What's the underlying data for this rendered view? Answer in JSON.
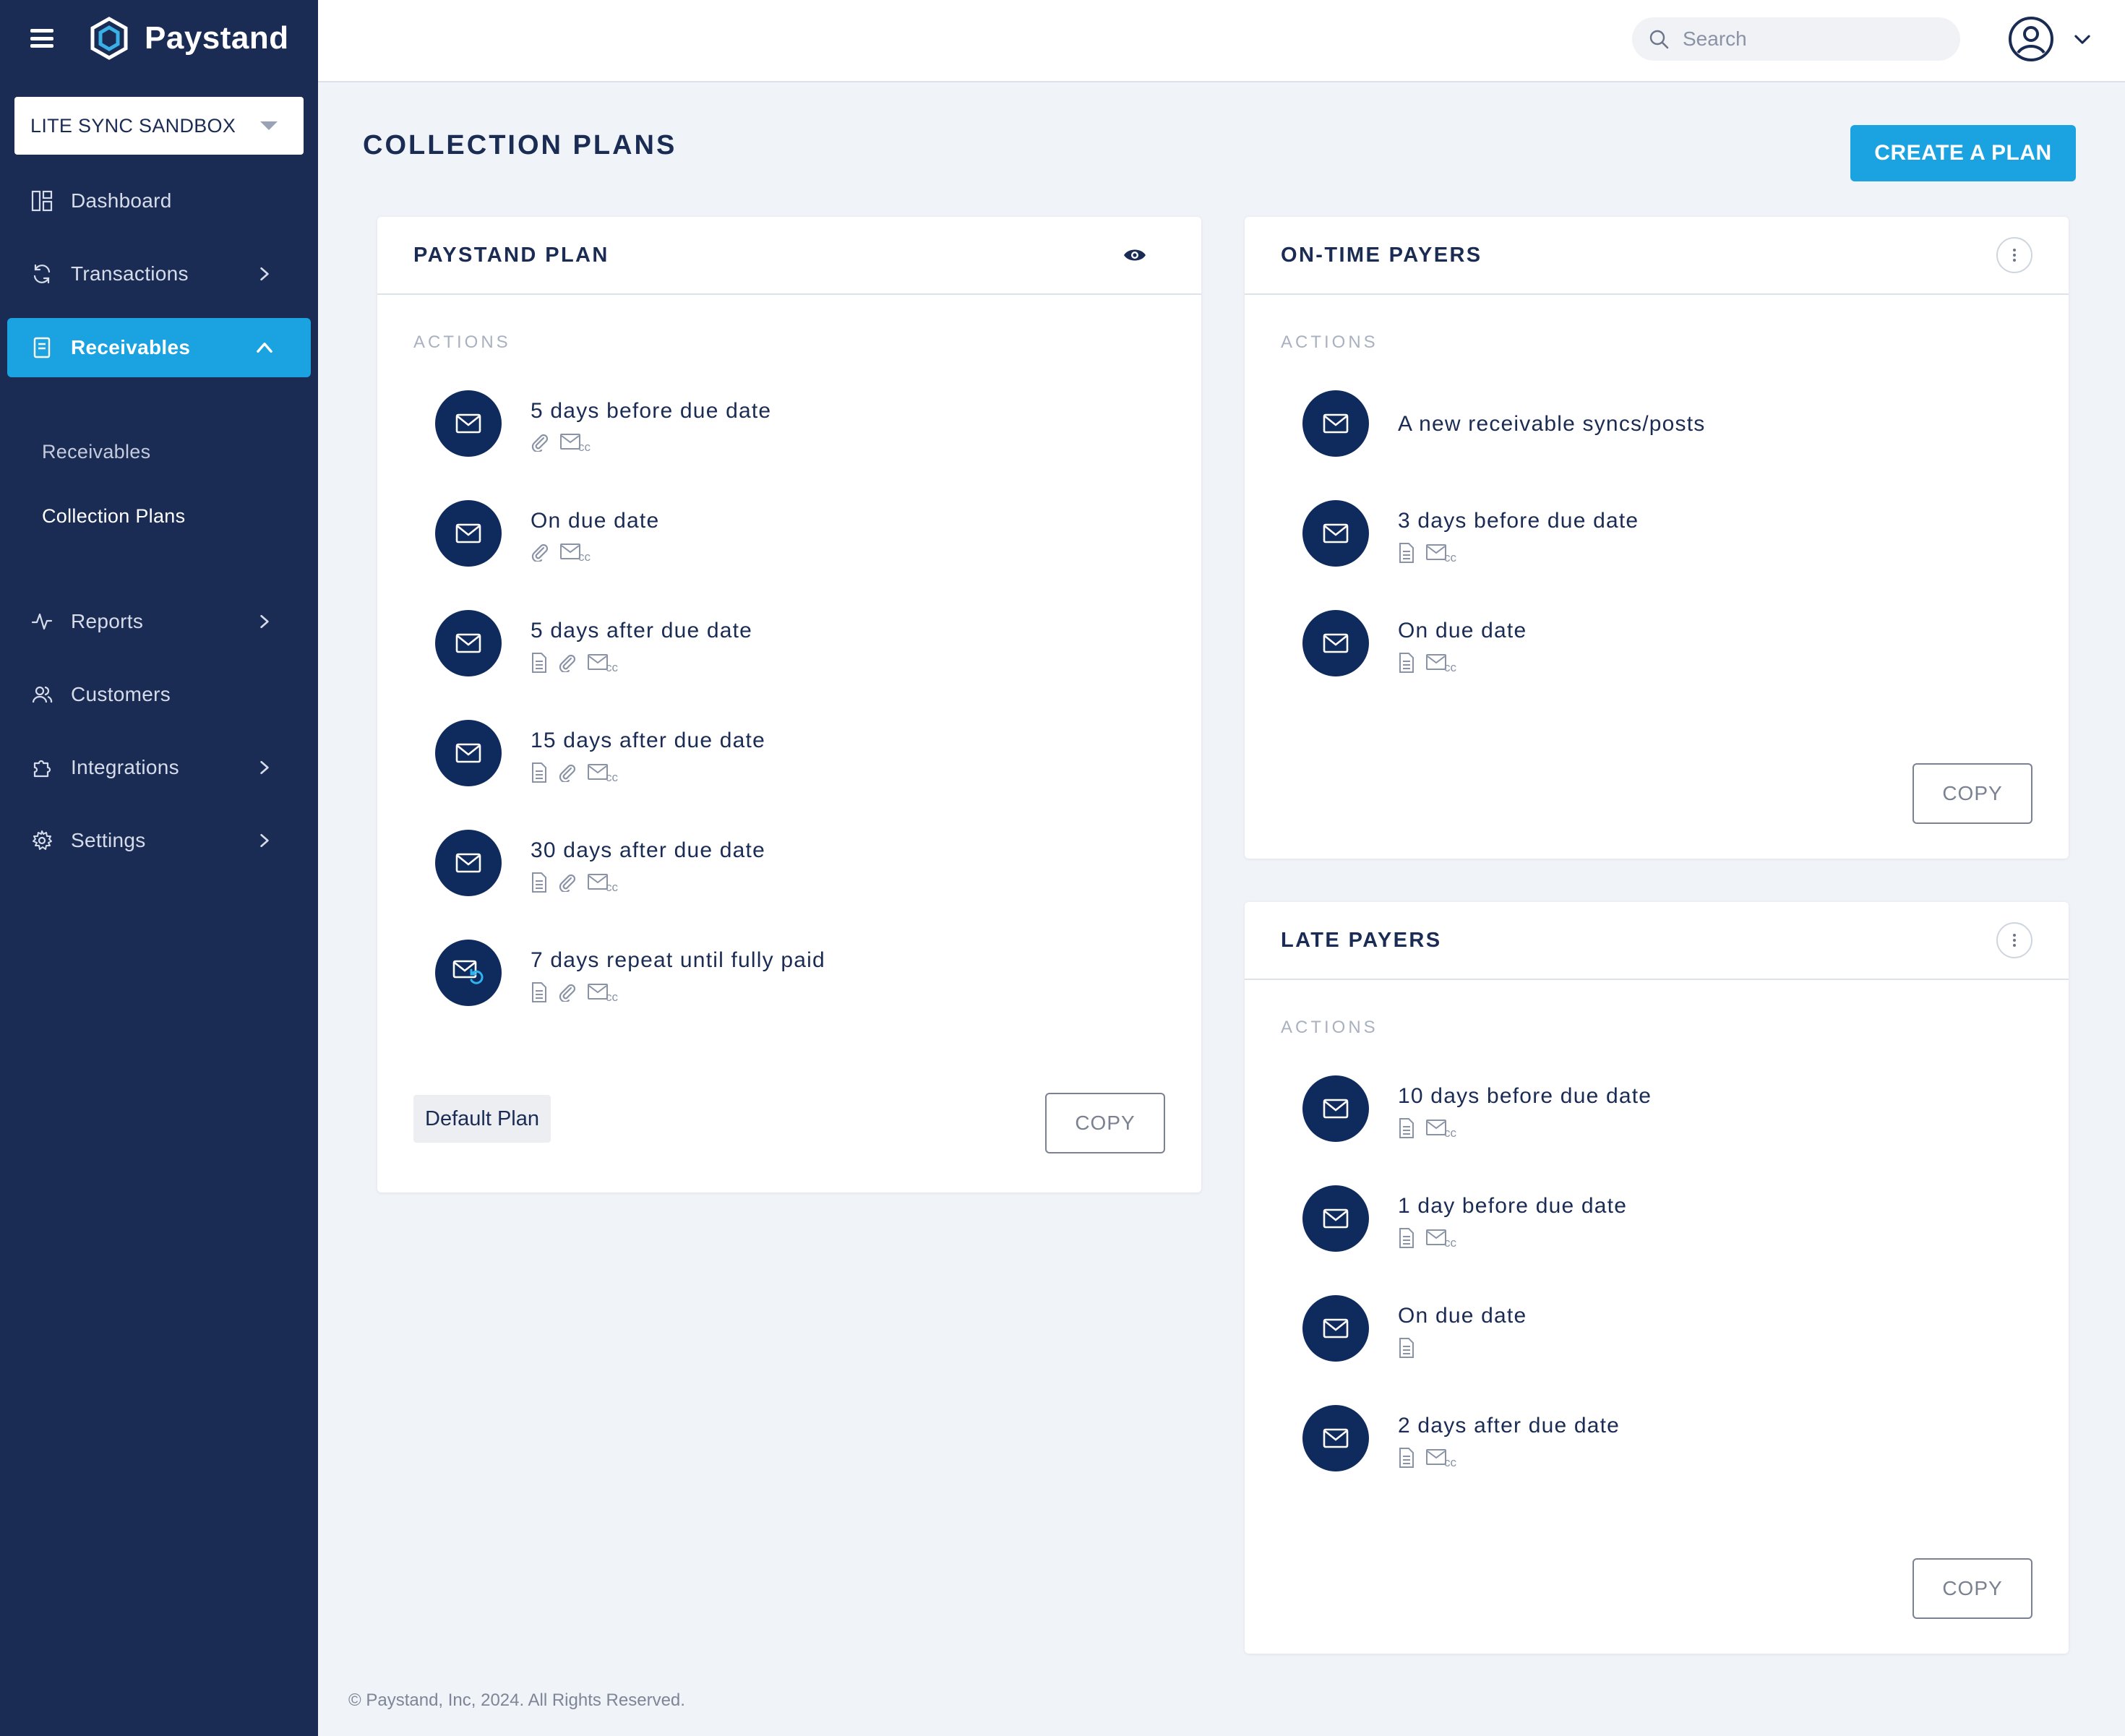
{
  "brand": {
    "name": "Paystand"
  },
  "org_select": {
    "value": "LITE SYNC SANDBOX"
  },
  "sidebar": {
    "items": [
      {
        "label": "Dashboard"
      },
      {
        "label": "Transactions"
      },
      {
        "label": "Receivables"
      },
      {
        "label": "Reports"
      },
      {
        "label": "Customers"
      },
      {
        "label": "Integrations"
      },
      {
        "label": "Settings"
      }
    ],
    "sub_items": [
      {
        "label": "Receivables"
      },
      {
        "label": "Collection Plans"
      }
    ]
  },
  "topbar": {
    "search_placeholder": "Search"
  },
  "page": {
    "title": "COLLECTION PLANS",
    "create_label": "CREATE A PLAN"
  },
  "cards": {
    "paystand": {
      "title": "PAYSTAND PLAN",
      "actions_label": "ACTIONS",
      "actions": [
        {
          "title": "5 days before due date"
        },
        {
          "title": "On due date"
        },
        {
          "title": "5 days after due date"
        },
        {
          "title": "15 days after due date"
        },
        {
          "title": "30 days after due date"
        },
        {
          "title": "7 days repeat until fully paid"
        }
      ],
      "badge": "Default Plan",
      "copy_label": "COPY"
    },
    "ontime": {
      "title": "ON-TIME PAYERS",
      "actions_label": "ACTIONS",
      "actions": [
        {
          "title": "A new receivable syncs/posts"
        },
        {
          "title": "3 days before due date"
        },
        {
          "title": "On due date"
        }
      ],
      "copy_label": "COPY"
    },
    "late": {
      "title": "LATE PAYERS",
      "actions_label": "ACTIONS",
      "actions": [
        {
          "title": "10 days before due date"
        },
        {
          "title": "1 day before due date"
        },
        {
          "title": "On due date"
        },
        {
          "title": "2 days after due date"
        }
      ],
      "copy_label": "COPY"
    }
  },
  "footer": {
    "text": "© Paystand, Inc, 2024. All Rights Reserved."
  },
  "colors": {
    "sidebar": "#1a2b54",
    "accent": "#1aa3e0",
    "action_circle": "#0f2a5c",
    "background": "#f0f3f8"
  }
}
